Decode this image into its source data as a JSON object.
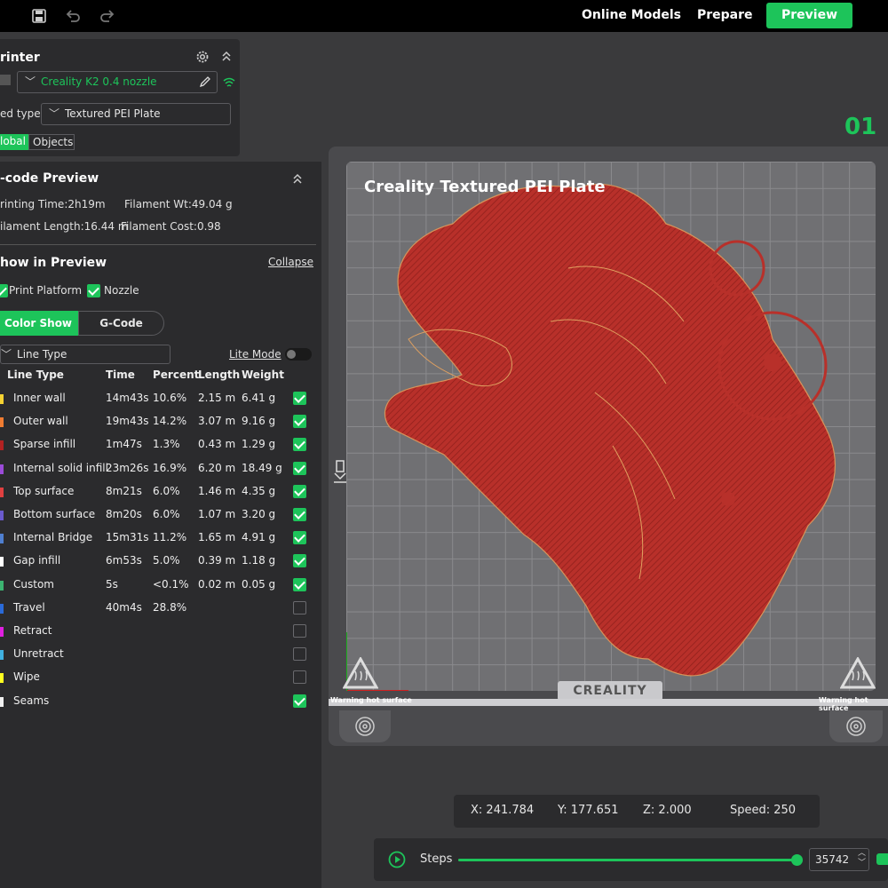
{
  "topbar": {
    "nav": [
      "Online Models",
      "Prepare"
    ],
    "preview_label": "Preview"
  },
  "printer": {
    "title": "rinter",
    "printer_select": "Creality K2 0.4 nozzle",
    "bed_type_label": "ed type",
    "bed_type": "Textured PEI Plate",
    "tabs": [
      "lobal",
      "Objects"
    ]
  },
  "gcode": {
    "title": "-code Preview",
    "printing_time": "rinting Time:2h19m",
    "filament_wt": "Filament Wt:49.04 g",
    "filament_length": "ilament Length:16.44 m",
    "filament_cost": "Filament Cost:0.98",
    "show_title": "how in Preview",
    "collapse_label": "Collapse",
    "print_platform_label": "Print Platform",
    "nozzle_label": "Nozzle",
    "color_show_label": "Color Show",
    "gcode_tab_label": "G-Code",
    "line_type_select": "Line Type",
    "lite_mode_label": "Lite Mode",
    "columns": [
      "Line Type",
      "Time",
      "Percent",
      "Length",
      "Weight"
    ],
    "rows": [
      {
        "name": "Inner wall",
        "time": "14m43s",
        "percent": "10.6%",
        "length": "2.15 m",
        "weight": "6.41 g",
        "color": "#f5d232",
        "checked": true
      },
      {
        "name": "Outer wall",
        "time": "19m43s",
        "percent": "14.2%",
        "length": "3.07 m",
        "weight": "9.16 g",
        "color": "#f07c32",
        "checked": true
      },
      {
        "name": "Sparse infill",
        "time": "1m47s",
        "percent": "1.3%",
        "length": "0.43 m",
        "weight": "1.29 g",
        "color": "#b22222",
        "checked": true
      },
      {
        "name": "Internal solid infill",
        "time": "23m26s",
        "percent": "16.9%",
        "length": "6.20 m",
        "weight": "18.49 g",
        "color": "#9b4bd8",
        "checked": true
      },
      {
        "name": "Top surface",
        "time": "8m21s",
        "percent": "6.0%",
        "length": "1.46 m",
        "weight": "4.35 g",
        "color": "#e04040",
        "checked": true
      },
      {
        "name": "Bottom surface",
        "time": "8m20s",
        "percent": "6.0%",
        "length": "1.07 m",
        "weight": "3.20 g",
        "color": "#6a5acd",
        "checked": true
      },
      {
        "name": "Internal Bridge",
        "time": "15m31s",
        "percent": "11.2%",
        "length": "1.65 m",
        "weight": "4.91 g",
        "color": "#4f7fd0",
        "checked": true
      },
      {
        "name": "Gap infill",
        "time": "6m53s",
        "percent": "5.0%",
        "length": "0.39 m",
        "weight": "1.18 g",
        "color": "#ffffff",
        "checked": true
      },
      {
        "name": "Custom",
        "time": "5s",
        "percent": "<0.1%",
        "length": "0.02 m",
        "weight": "0.05 g",
        "color": "#3cb371",
        "checked": true
      },
      {
        "name": "Travel",
        "time": "40m4s",
        "percent": "28.8%",
        "length": "",
        "weight": "",
        "color": "#2a6ad8",
        "checked": false
      },
      {
        "name": "Retract",
        "time": "",
        "percent": "",
        "length": "",
        "weight": "",
        "color": "#e020e0",
        "checked": false
      },
      {
        "name": "Unretract",
        "time": "",
        "percent": "",
        "length": "",
        "weight": "",
        "color": "#40b0e0",
        "checked": false
      },
      {
        "name": "Wipe",
        "time": "",
        "percent": "",
        "length": "",
        "weight": "",
        "color": "#ffff20",
        "checked": false
      },
      {
        "name": "Seams",
        "time": "",
        "percent": "",
        "length": "",
        "weight": "",
        "color": "#f0f0f0",
        "checked": true
      }
    ]
  },
  "plate": {
    "title": "Creality Textured PEI Plate",
    "number": "01",
    "brand": "CREALITY",
    "warning_left": "Warning hot surface",
    "warning_right": "Warning hot surface"
  },
  "coords": {
    "x": "X: 241.784",
    "y": "Y: 177.651",
    "z": "Z: 2.000",
    "speed": "Speed: 250"
  },
  "steps": {
    "label": "Steps",
    "value": "35742",
    "progress": 1.0
  },
  "colors": {
    "accent": "#1dc45a",
    "model": "#b8302a"
  }
}
